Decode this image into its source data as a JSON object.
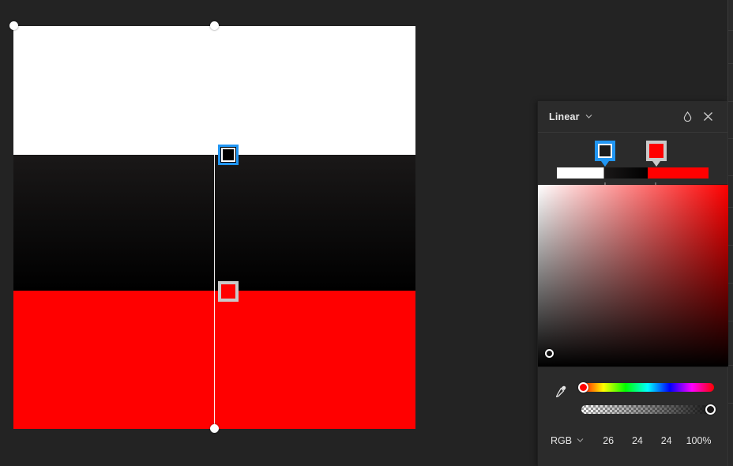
{
  "app": {
    "background_color": "#232323",
    "panel_background": "#2b2b2b"
  },
  "canvas": {
    "name": "artboard",
    "gradient_type": "linear",
    "direction": "vertical",
    "angle_degrees": 90,
    "stops": [
      {
        "position_percent": 0,
        "color": "#ffffff",
        "label": "white-stop"
      },
      {
        "position_percent": 32,
        "color": "#1a1818",
        "label": "black-stop",
        "selected": true
      },
      {
        "position_percent": 66,
        "color": "#ff0000",
        "label": "red-stop"
      }
    ],
    "handles": {
      "start_dot": "gradient-start-handle",
      "end_dot": "gradient-end-handle",
      "origin_dot": "gradient-origin-dot"
    },
    "on_canvas_stops": [
      {
        "color": "#000000",
        "selected": true,
        "selection_color": "#2196f3"
      },
      {
        "color": "#ff0000",
        "selected": false,
        "selection_color": "#c9c9c9"
      }
    ]
  },
  "panel": {
    "title": "Linear",
    "type_chevron": "chevron-down-icon",
    "opacity_icon": "opacity-drop-icon",
    "close_icon": "close-icon",
    "stops": [
      {
        "color": "#1b1b1b",
        "selected": true,
        "outline": "#2196f3"
      },
      {
        "color": "#ff0000",
        "selected": false,
        "outline": "#c9c9c9"
      }
    ],
    "preview_gradient": "white to black to red",
    "sv_field": {
      "name": "saturation-value-field",
      "base_hue": "#ff0000",
      "cursor_position": {
        "saturation_percent": 6,
        "value_percent": 6
      }
    },
    "eyedropper_icon": "eyedropper-icon",
    "hue_slider": {
      "name": "hue-slider",
      "hue_degrees": 0,
      "knob_color": "#ff0000"
    },
    "alpha_slider": {
      "name": "alpha-slider",
      "alpha_percent": 100,
      "knob_color": "#1a1818"
    },
    "values": {
      "mode": "RGB",
      "mode_chevron": "chevron-down-icon",
      "r": "26",
      "g": "24",
      "b": "24",
      "alpha": "100%"
    }
  }
}
